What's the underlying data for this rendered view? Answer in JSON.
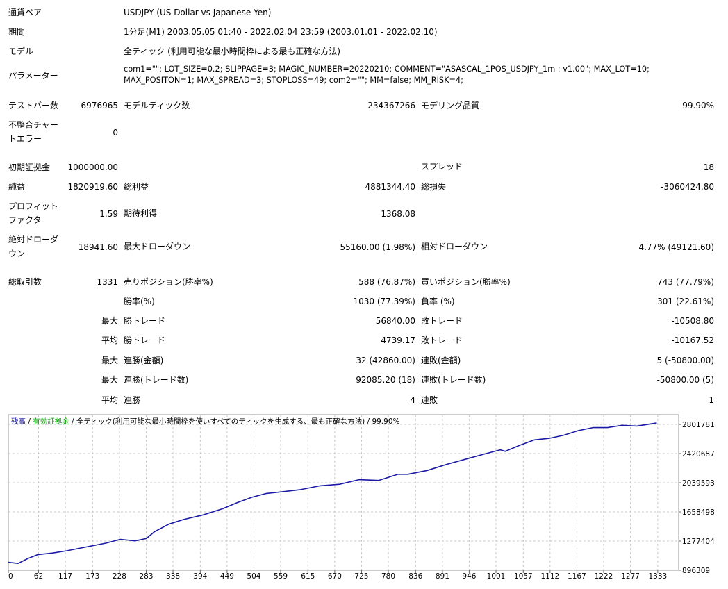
{
  "settings": {
    "symbol_label": "通貨ペア",
    "symbol": "USDJPY (US Dollar vs Japanese Yen)",
    "period_label": "期間",
    "period": "1分足(M1) 2003.05.05 01:40 - 2022.02.04 23:59 (2003.01.01 - 2022.02.10)",
    "model_label": "モデル",
    "model": "全ティック (利用可能な最小時間枠による最も正確な方法)",
    "params_label": "パラメーター",
    "params_line1": "com1=\"\"; LOT_SIZE=0.2; SLIPPAGE=3; MAGIC_NUMBER=20220210; COMMENT=\"ASASCAL_1POS_USDJPY_1m : v1.00\"; MAX_LOT=10;",
    "params_line2": "MAX_POSITON=1; MAX_SPREAD=3; STOPLOSS=49; com2=\"\"; MM=false; MM_RISK=4;"
  },
  "stats": {
    "bars_label": "テストバー数",
    "bars": "6976965",
    "ticks_label": "モデルティック数",
    "ticks": "234367266",
    "quality_label": "モデリング品質",
    "quality": "99.90%",
    "mismatch_label_1": "不整合チャー",
    "mismatch_label_2": "トエラー",
    "mismatch": "0",
    "deposit_label": "初期証拠金",
    "deposit": "1000000.00",
    "spread_label": "スプレッド",
    "spread": "18",
    "net_label": "純益",
    "net": "1820919.60",
    "gross_profit_label": "総利益",
    "gross_profit": "4881344.40",
    "gross_loss_label": "総損失",
    "gross_loss": "-3060424.80",
    "pf_label_1": "プロフィット",
    "pf_label_2": "ファクタ",
    "pf": "1.59",
    "expected_label": "期待利得",
    "expected": "1368.08",
    "abs_dd_label_1": "絶対ドローダ",
    "abs_dd_label_2": "ウン",
    "abs_dd": "18941.60",
    "max_dd_label": "最大ドローダウン",
    "max_dd": "55160.00 (1.98%)",
    "rel_dd_label": "相対ドローダウン",
    "rel_dd": "4.77% (49121.60)",
    "total_trades_label": "総取引数",
    "total_trades": "1331",
    "short_label": "売りポジション(勝率%)",
    "short": "588 (76.87%)",
    "long_label": "買いポジション(勝率%)",
    "long": "743 (77.79%)",
    "win_rate_label": "勝率(%)",
    "win_rate": "1030 (77.39%)",
    "loss_rate_label": "負率 (%)",
    "loss_rate": "301 (22.61%)",
    "max_prefix": "最大",
    "avg_prefix": "平均",
    "largest_win_label": "勝トレード",
    "largest_win": "56840.00",
    "largest_loss_label": "敗トレード",
    "largest_loss": "-10508.80",
    "avg_win_label": "勝トレード",
    "avg_win": "4739.17",
    "avg_loss_label": "敗トレード",
    "avg_loss": "-10167.52",
    "max_cons_win_amt_label": "連勝(金額)",
    "max_cons_win_amt": "32 (42860.00)",
    "max_cons_loss_amt_label": "連敗(金額)",
    "max_cons_loss_amt": "5 (-50800.00)",
    "max_cons_win_cnt_label": "連勝(トレード数)",
    "max_cons_win_cnt": "92085.20 (18)",
    "max_cons_loss_cnt_label": "連敗(トレード数)",
    "max_cons_loss_cnt": "-50800.00 (5)",
    "avg_cons_win_label": "連勝",
    "avg_cons_win": "4",
    "avg_cons_loss_label": "連敗",
    "avg_cons_loss": "1"
  },
  "chart_data": {
    "type": "line",
    "legend": {
      "balance": "残高",
      "sep1": " / ",
      "equity": "有効証拠金",
      "sep2": " / ",
      "model": "全ティック(利用可能な最小時間枠を使いすべてのティックを生成する、最も正確な方法)",
      "sep3": " / ",
      "quality": "99.90%"
    },
    "colors": {
      "balance": "#1a1aa6",
      "equity": "#00a000",
      "grid": "#c8c8c8"
    },
    "xlim": [
      0,
      1376
    ],
    "ylim": [
      896309,
      2929000
    ],
    "x_ticks": [
      0,
      62,
      117,
      173,
      228,
      283,
      338,
      394,
      449,
      504,
      559,
      615,
      670,
      725,
      780,
      836,
      891,
      946,
      1001,
      1057,
      1112,
      1167,
      1222,
      1277,
      1333
    ],
    "y_ticks": [
      896309,
      1277404,
      1658498,
      2039593,
      2420687,
      2801781
    ],
    "series": [
      {
        "x": [
          0,
          20,
          40,
          60,
          90,
          120,
          160,
          200,
          230,
          260,
          283,
          300,
          330,
          360,
          400,
          440,
          470,
          500,
          530,
          560,
          600,
          640,
          680,
          720,
          760,
          800,
          820,
          860,
          900,
          940,
          980,
          1010,
          1020,
          1050,
          1080,
          1110,
          1140,
          1170,
          1200,
          1230,
          1260,
          1290,
          1331
        ],
        "y": [
          1000000,
          985000,
          1050000,
          1100000,
          1120000,
          1150000,
          1200000,
          1250000,
          1300000,
          1280000,
          1310000,
          1400000,
          1500000,
          1560000,
          1620000,
          1700000,
          1780000,
          1850000,
          1900000,
          1920000,
          1950000,
          2000000,
          2020000,
          2080000,
          2070000,
          2150000,
          2150000,
          2200000,
          2280000,
          2350000,
          2420000,
          2470000,
          2450000,
          2530000,
          2600000,
          2620000,
          2660000,
          2720000,
          2760000,
          2760000,
          2790000,
          2780000,
          2821000
        ]
      }
    ]
  }
}
